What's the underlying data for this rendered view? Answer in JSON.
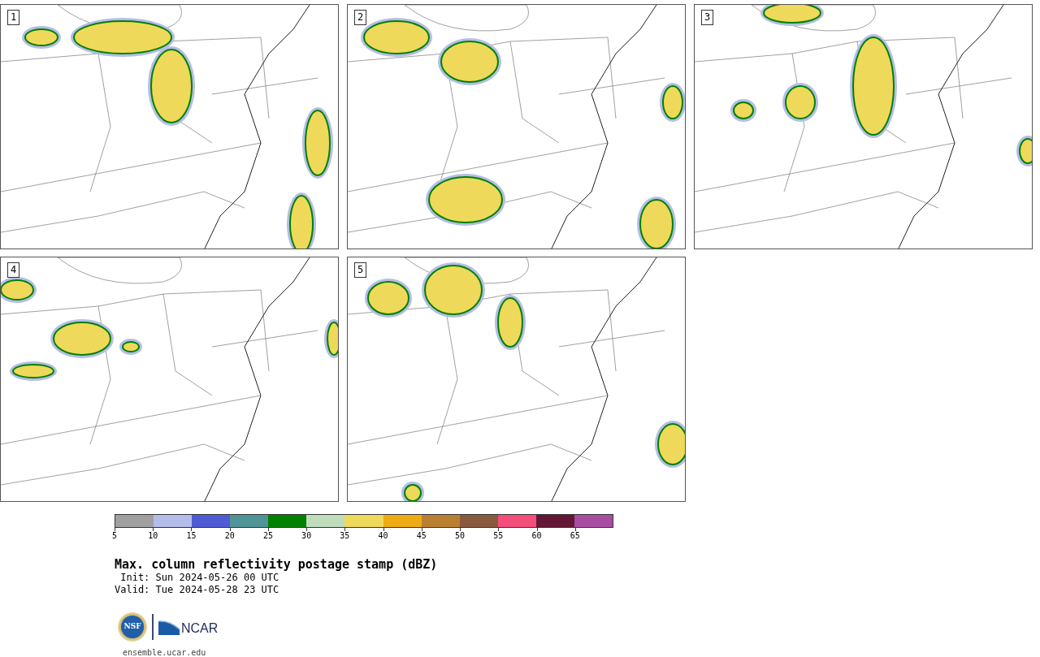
{
  "panels": [
    {
      "label": "1"
    },
    {
      "label": "2"
    },
    {
      "label": "3"
    },
    {
      "label": "4"
    },
    {
      "label": "5"
    }
  ],
  "colorbar": {
    "segments": [
      {
        "color": "#a0a0a0"
      },
      {
        "color": "#b4bde9"
      },
      {
        "color": "#4f5bd5"
      },
      {
        "color": "#4f9598"
      },
      {
        "color": "#008200"
      },
      {
        "color": "#bfdcbc"
      },
      {
        "color": "#eed95a"
      },
      {
        "color": "#eeab14"
      },
      {
        "color": "#b98032"
      },
      {
        "color": "#8a5a3e"
      },
      {
        "color": "#f34f7a"
      },
      {
        "color": "#621835"
      },
      {
        "color": "#a84ca2"
      }
    ],
    "ticks": [
      "5",
      "10",
      "15",
      "20",
      "25",
      "30",
      "35",
      "40",
      "45",
      "50",
      "55",
      "60",
      "65"
    ]
  },
  "title": "Max. column reflectivity postage stamp (dBZ)",
  "init": " Init: Sun 2024-05-26 00 UTC",
  "valid": "Valid: Tue 2024-05-28 23 UTC",
  "logo": {
    "nsf": "NSF",
    "ncar": "NCAR"
  },
  "url": "ensemble.ucar.edu"
}
